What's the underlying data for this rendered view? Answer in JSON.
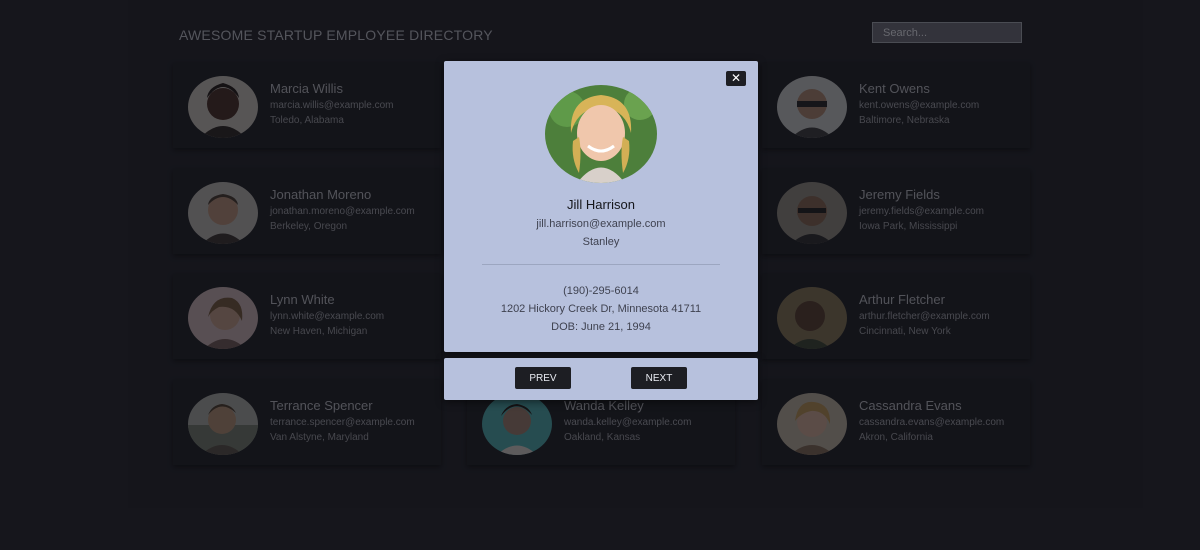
{
  "header": {
    "title": "Awesome Startup Employee Directory",
    "search_placeholder": "Search..."
  },
  "employees": [
    {
      "name": "Marcia Willis",
      "email": "marcia.willis@example.com",
      "location": "Toledo, Alabama"
    },
    {
      "name": "Kent Owens",
      "email": "kent.owens@example.com",
      "location": "Baltimore, Nebraska"
    },
    {
      "name": "Jonathan Moreno",
      "email": "jonathan.moreno@example.com",
      "location": "Berkeley, Oregon"
    },
    {
      "name": "Jeremy Fields",
      "email": "jeremy.fields@example.com",
      "location": "Iowa Park, Mississippi"
    },
    {
      "name": "Lynn White",
      "email": "lynn.white@example.com",
      "location": "New Haven, Michigan"
    },
    {
      "name": "Arthur Fletcher",
      "email": "arthur.fletcher@example.com",
      "location": "Cincinnati, New York"
    },
    {
      "name": "Terrance Spencer",
      "email": "terrance.spencer@example.com",
      "location": "Van Alstyne, Maryland"
    },
    {
      "name": "Wanda Kelley",
      "email": "wanda.kelley@example.com",
      "location": "Oakland, Kansas"
    },
    {
      "name": "Cassandra Evans",
      "email": "cassandra.evans@example.com",
      "location": "Akron, California"
    }
  ],
  "modal": {
    "close_symbol": "✕",
    "name": "Jill Harrison",
    "email": "jill.harrison@example.com",
    "city": "Stanley",
    "phone": "(190)-295-6014",
    "address": "1202 Hickory Creek Dr, Minnesota 41711",
    "dob": "DOB: June 21, 1994",
    "prev_label": "PREV",
    "next_label": "NEXT"
  },
  "colors": {
    "background": "#1c1d23",
    "card": "#1a1b20",
    "modal": "#b7c1dd",
    "button": "#1d1e23"
  }
}
